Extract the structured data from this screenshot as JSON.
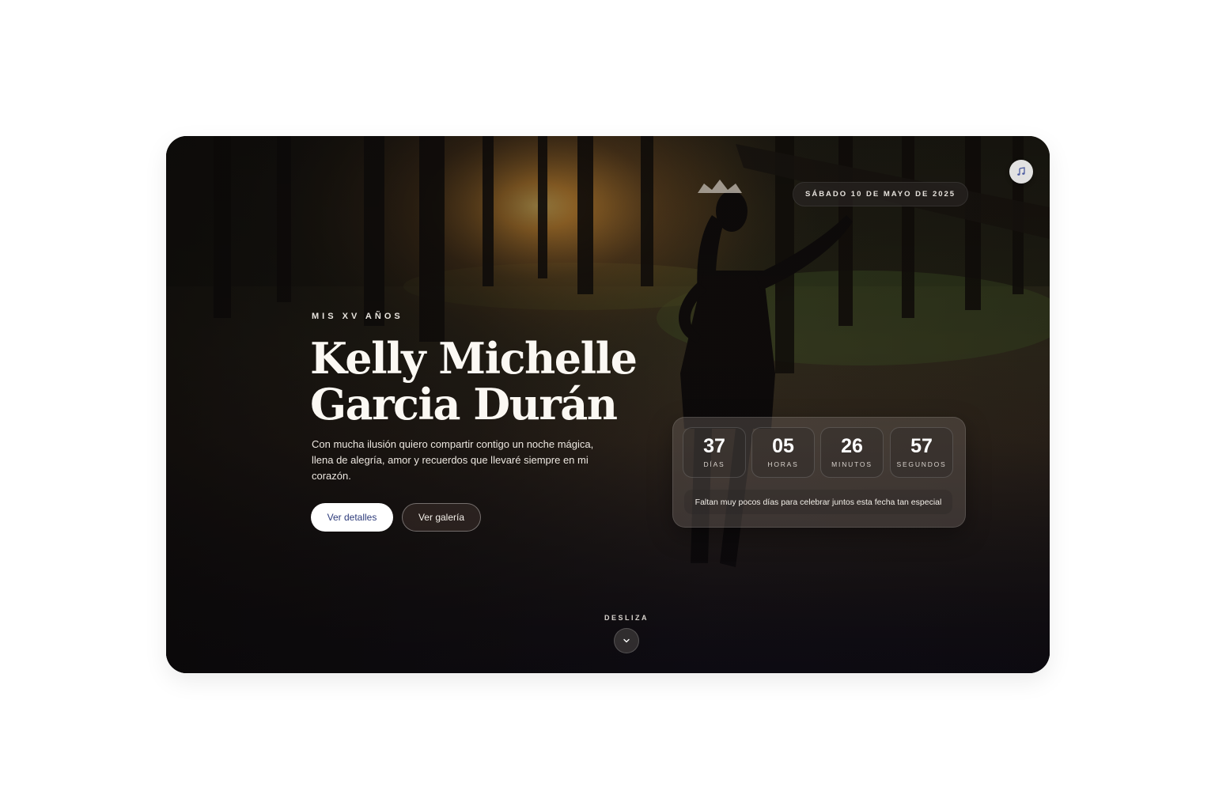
{
  "hero": {
    "eyebrow": "MIS XV AÑOS",
    "name_line1": "Kelly Michelle",
    "name_line2": "Garcia Durán",
    "description": "Con mucha ilusión quiero compartir contigo un noche mágica, llena de alegría, amor y recuerdos que llevaré siempre en mi corazón.",
    "date": "SÁBADO 10 DE MAYO DE 2025",
    "music_icon": "music-note-icon",
    "buttons": {
      "details": "Ver detalles",
      "gallery": "Ver galería"
    }
  },
  "countdown": {
    "days": {
      "value": "37",
      "label": "DÍAS"
    },
    "hours": {
      "value": "05",
      "label": "HORAS"
    },
    "minutes": {
      "value": "26",
      "label": "MINUTOS"
    },
    "seconds": {
      "value": "57",
      "label": "SEGUNDOS"
    },
    "message": "Faltan muy pocos días para celebrar juntos esta fecha tan especial"
  },
  "scroll": {
    "label": "DESLIZA",
    "icon": "chevron-down-icon"
  },
  "colors": {
    "primary_button_text": "#2c3a7a",
    "text_light": "#fbf8f3"
  }
}
